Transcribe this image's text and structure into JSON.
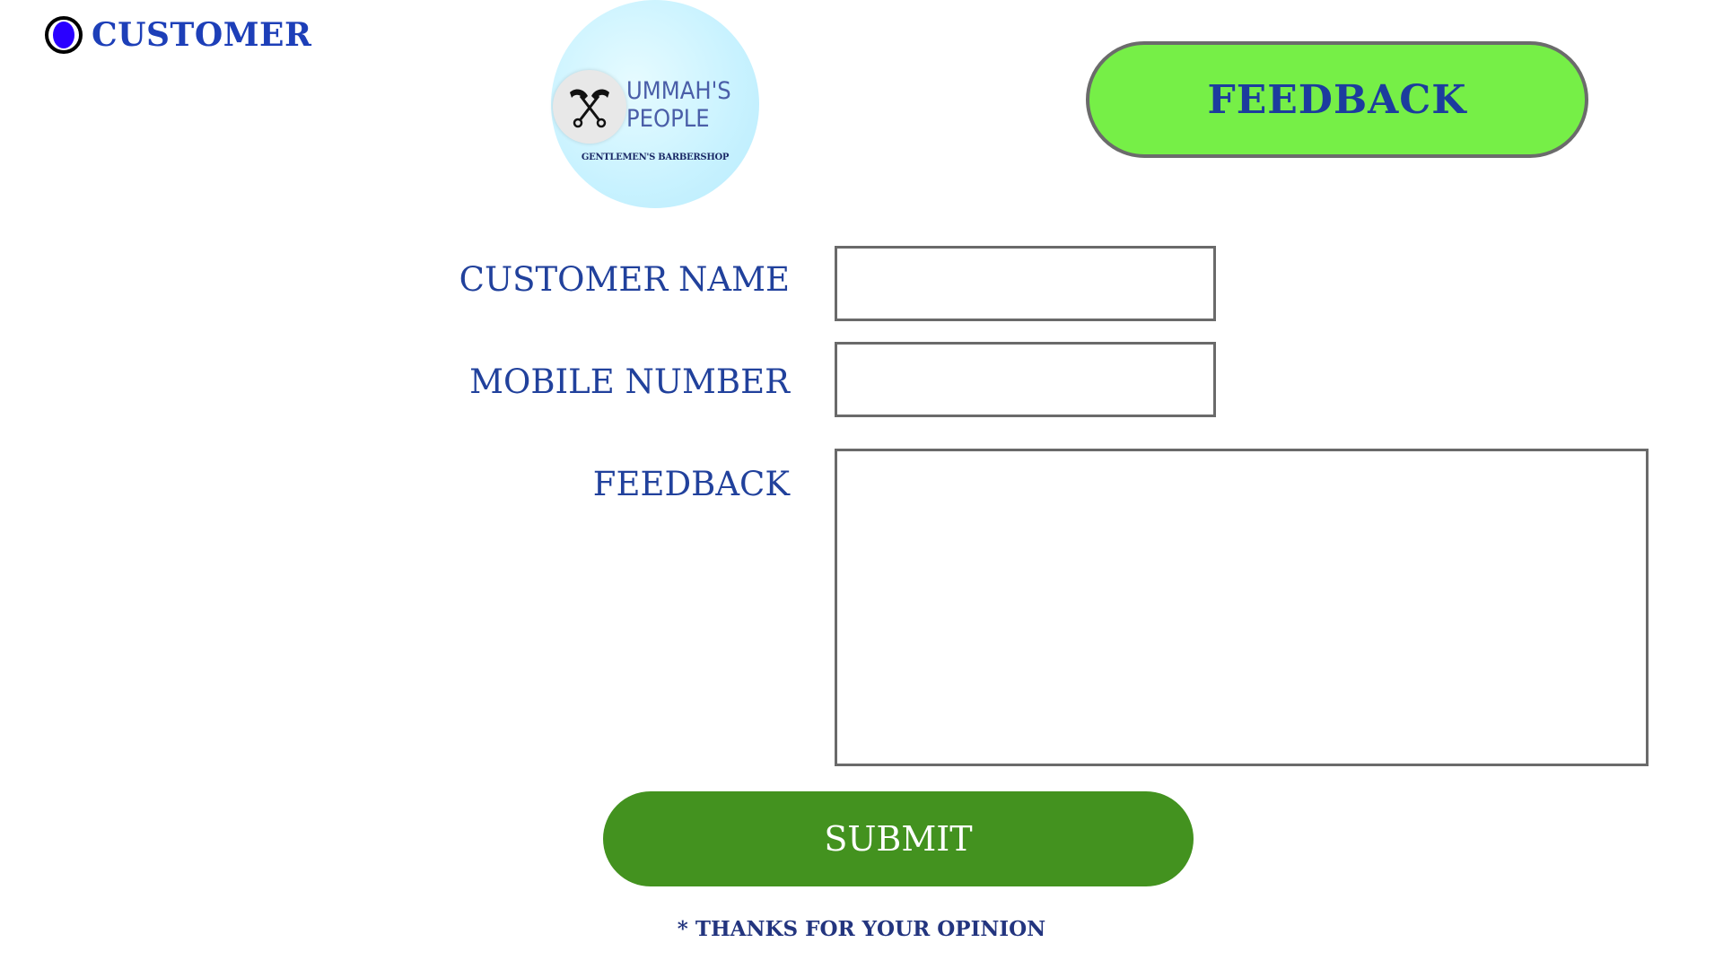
{
  "nav": {
    "customer_label": "CUSTOMER",
    "customer_selected": true
  },
  "logo": {
    "title_line1": "UMMAH'S",
    "title_line2": "PEOPLE",
    "subtitle": "GENTLEMEN'S BARBERSHOP",
    "emblem_icon": "barber-scissors-icon"
  },
  "header": {
    "feedback_button_label": "FEEDBACK"
  },
  "form": {
    "name_label": "CUSTOMER NAME",
    "name_value": "",
    "mobile_label": "MOBILE NUMBER",
    "mobile_value": "",
    "feedback_label": "FEEDBACK",
    "feedback_value": "",
    "submit_label": "SUBMIT",
    "thanks_text": "* THANKS FOR YOUR OPINION"
  },
  "colors": {
    "accent_green": "#76ef47",
    "submit_green": "#43921f",
    "label_blue": "#21419c",
    "radio_fill": "#2a00ff"
  }
}
